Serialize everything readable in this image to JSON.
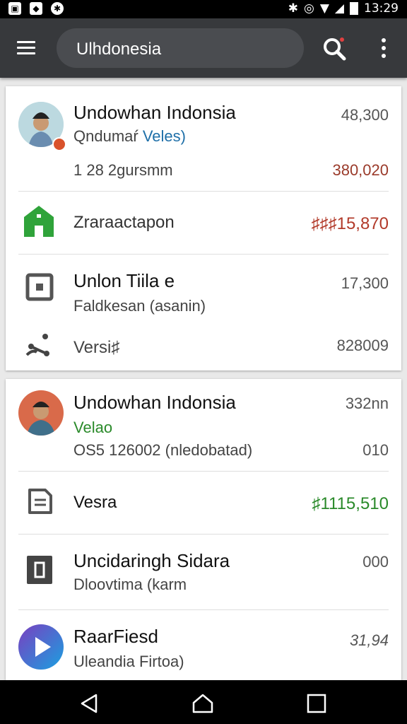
{
  "status_bar": {
    "time": "13:29"
  },
  "app_bar": {
    "search_text": "Ulhdonesia"
  },
  "colors": {
    "appbar": "#37393c",
    "red": "#b23a2a",
    "green": "#2a8a2a",
    "blue": "#1e6fa8"
  },
  "card1": {
    "item1": {
      "title": "Undowhan Indonsia",
      "subtitle_a": "Qndumaŕ",
      "subtitle_b": "Veles)",
      "line3": "1 28 2gursmm",
      "amount1": "48,300",
      "amount2": "380,020"
    },
    "item2": {
      "title": "Zraraactapon",
      "amount": "♯♯♯15,870"
    },
    "item3": {
      "title": "Unlon Tiila e",
      "subtitle": "Faldkesan (asanin)",
      "amount": "17,300"
    },
    "item4": {
      "title": "Versi♯",
      "amount": "828009"
    }
  },
  "card2": {
    "item1": {
      "title": "Undowhan Indonsia",
      "subtitle": "Velao",
      "line3": "OS5 126002 (nledobatad)",
      "amount1": "332nn",
      "amount2": "010"
    },
    "item2": {
      "title": "Vesra",
      "amount": "♯1115,510"
    },
    "item3": {
      "title": "Uncidaringh Sidara",
      "subtitle": "Dloovtima (karm",
      "amount": "000"
    },
    "item4": {
      "title": "RaarFiesd",
      "subtitle": "Uleandia Firtoa)",
      "amount": "31,94"
    }
  }
}
